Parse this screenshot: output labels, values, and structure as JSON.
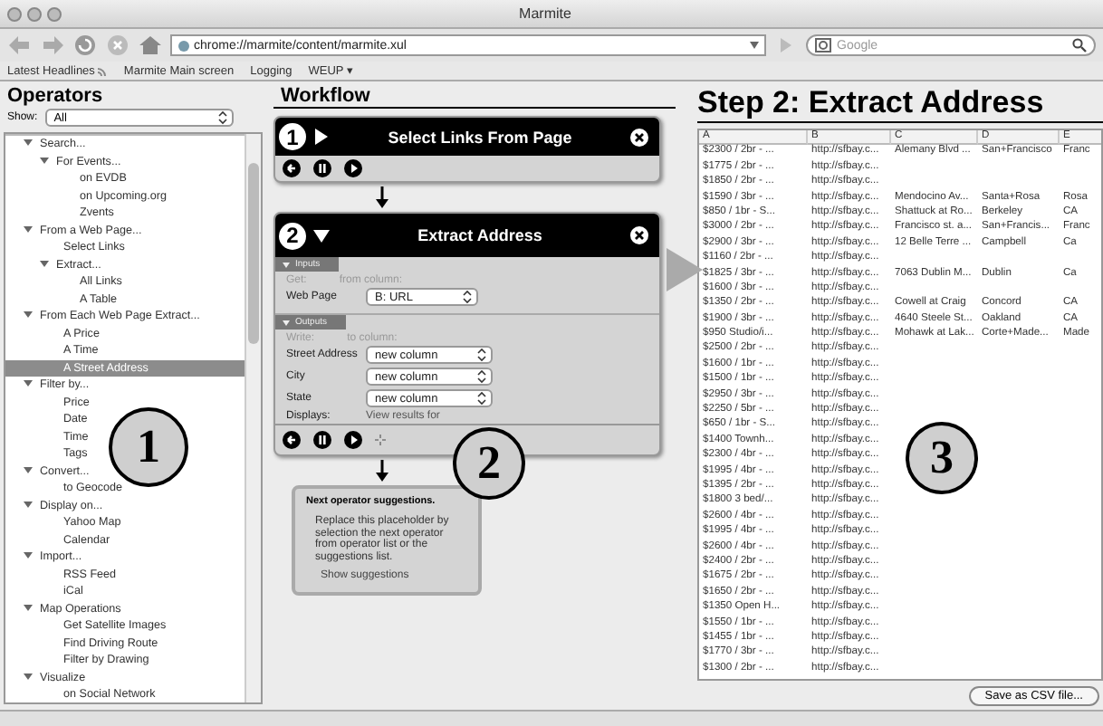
{
  "window": {
    "title": "Marmite"
  },
  "toolbar": {
    "url": "chrome://marmite/content/marmite.xul",
    "search_placeholder": "Google"
  },
  "bookmarks": [
    {
      "label": "Latest Headlines",
      "kind": "feed"
    },
    {
      "label": "Marmite Main screen",
      "kind": "link"
    },
    {
      "label": "Logging",
      "kind": "link"
    },
    {
      "label": "WEUP ▾",
      "kind": "link"
    }
  ],
  "operators": {
    "title": "Operators",
    "show_label": "Show:",
    "show_value": "All",
    "tree": [
      {
        "label": "Search...",
        "expanded": true,
        "selected": false,
        "children": [
          {
            "label": "For Events...",
            "expanded": true,
            "selected": false,
            "children": [
              {
                "label": "on EVDB",
                "selected": false
              },
              {
                "label": "on Upcoming.org",
                "selected": false
              },
              {
                "label": "Zvents",
                "selected": false
              }
            ]
          }
        ]
      },
      {
        "label": "From a Web Page...",
        "expanded": true,
        "selected": false,
        "children": [
          {
            "label": "Select Links",
            "selected": false
          },
          {
            "label": "Extract...",
            "expanded": true,
            "selected": false,
            "children": [
              {
                "label": "All Links",
                "selected": false
              },
              {
                "label": "A Table",
                "selected": false
              }
            ]
          }
        ]
      },
      {
        "label": "From Each Web Page Extract...",
        "expanded": true,
        "selected": false,
        "children": [
          {
            "label": "A Price",
            "selected": false
          },
          {
            "label": "A Time",
            "selected": false
          },
          {
            "label": "A Street Address",
            "selected": true
          }
        ]
      },
      {
        "label": "Filter by...",
        "expanded": true,
        "selected": false,
        "children": [
          {
            "label": "Price",
            "selected": false
          },
          {
            "label": "Date",
            "selected": false
          },
          {
            "label": "Time",
            "selected": false
          },
          {
            "label": "Tags",
            "selected": false
          }
        ]
      },
      {
        "label": "Convert...",
        "expanded": true,
        "selected": false,
        "children": [
          {
            "label": "to Geocode",
            "selected": false
          }
        ]
      },
      {
        "label": "Display on...",
        "expanded": true,
        "selected": false,
        "children": [
          {
            "label": "Yahoo Map",
            "selected": false
          },
          {
            "label": "Calendar",
            "selected": false
          }
        ]
      },
      {
        "label": "Import...",
        "expanded": true,
        "selected": false,
        "children": [
          {
            "label": "RSS Feed",
            "selected": false
          },
          {
            "label": "iCal",
            "selected": false
          }
        ]
      },
      {
        "label": "Map Operations",
        "expanded": true,
        "selected": false,
        "children": [
          {
            "label": "Get Satellite Images",
            "selected": false
          },
          {
            "label": "Find Driving Route",
            "selected": false
          },
          {
            "label": "Filter by Drawing",
            "selected": false
          }
        ]
      },
      {
        "label": "Visualize",
        "expanded": true,
        "selected": false,
        "children": [
          {
            "label": "on Social Network",
            "selected": false
          }
        ]
      }
    ]
  },
  "workflow": {
    "title": "Workflow",
    "steps": [
      {
        "number": "1",
        "title": "Select Links From Page",
        "expanded": false
      },
      {
        "number": "2",
        "title": "Extract Address",
        "expanded": true,
        "inputs_label": "Inputs",
        "get_label": "Get:",
        "from_label": "from column:",
        "input_fields": [
          {
            "label": "Web Page",
            "value": "B: URL"
          }
        ],
        "outputs_label": "Outputs",
        "write_label": "Write:",
        "to_label": "to column:",
        "output_fields": [
          {
            "label": "Street Address",
            "value": "new column"
          },
          {
            "label": "City",
            "value": "new column"
          },
          {
            "label": "State",
            "value": "new column"
          }
        ],
        "displays_label": "Displays:",
        "view_results": "View results for"
      }
    ],
    "suggestion": {
      "title": "Next operator suggestions.",
      "text": "Replace this placeholder by selection the next operator from operator list or the suggestions list.",
      "link": "Show suggestions"
    }
  },
  "results": {
    "title": "Step 2: Extract Address",
    "columns": [
      "A",
      "B",
      "C",
      "D",
      "E"
    ],
    "rows": [
      [
        "$2300 / 2br - ...",
        "http://sfbay.c...",
        "Alemany Blvd ...",
        "San+Francisco",
        "Franc"
      ],
      [
        "$1775 / 2br - ...",
        "http://sfbay.c..."
      ],
      [
        "$1850 / 2br - ...",
        "http://sfbay.c..."
      ],
      [
        "$1590 / 3br - ...",
        "http://sfbay.c...",
        "Mendocino Av...",
        "Santa+Rosa",
        "Rosa"
      ],
      [
        "$850 / 1br - S...",
        "http://sfbay.c...",
        "Shattuck at Ro...",
        "Berkeley",
        "CA"
      ],
      [
        "$3000 / 2br - ...",
        "http://sfbay.c...",
        "Francisco st. a...",
        "San+Francis...",
        "Franc"
      ],
      [
        "$2900 / 3br - ...",
        "http://sfbay.c...",
        "12 Belle Terre ...",
        "Campbell",
        "Ca"
      ],
      [
        "$1160 / 2br - ...",
        "http://sfbay.c..."
      ],
      [
        "$1825 / 3br - ...",
        "http://sfbay.c...",
        "7063 Dublin M...",
        "Dublin",
        "Ca"
      ],
      [
        "$1600 / 3br - ...",
        "http://sfbay.c..."
      ],
      [
        "$1350 / 2br - ...",
        "http://sfbay.c...",
        "Cowell at Craig",
        "Concord",
        "CA"
      ],
      [
        "$1900 / 3br - ...",
        "http://sfbay.c...",
        "4640 Steele St...",
        "Oakland",
        "CA"
      ],
      [
        "$950 Studio/i...",
        "http://sfbay.c...",
        "Mohawk at Lak...",
        "Corte+Made...",
        "Made"
      ],
      [
        "$2500 / 2br - ...",
        "http://sfbay.c..."
      ],
      [
        "$1600 / 1br - ...",
        "http://sfbay.c..."
      ],
      [
        "$1500 / 1br - ...",
        "http://sfbay.c..."
      ],
      [
        "$2950 / 3br - ...",
        "http://sfbay.c..."
      ],
      [
        "$2250 / 5br - ...",
        "http://sfbay.c..."
      ],
      [
        "$650 / 1br - S...",
        "http://sfbay.c..."
      ],
      [
        "$1400 Townh...",
        "http://sfbay.c..."
      ],
      [
        "$2300 / 4br - ...",
        "http://sfbay.c..."
      ],
      [
        "$1995 / 4br - ...",
        "http://sfbay.c..."
      ],
      [
        "$1395 / 2br - ...",
        "http://sfbay.c..."
      ],
      [
        "$1800 3 bed/...",
        "http://sfbay.c..."
      ],
      [
        "$2600 / 4br - ...",
        "http://sfbay.c..."
      ],
      [
        "$1995 / 4br - ...",
        "http://sfbay.c..."
      ],
      [
        "$2600 / 4br - ...",
        "http://sfbay.c..."
      ],
      [
        "$2400 / 2br - ...",
        "http://sfbay.c..."
      ],
      [
        "$1675 / 2br - ...",
        "http://sfbay.c..."
      ],
      [
        "$1650 / 2br - ...",
        "http://sfbay.c..."
      ],
      [
        "$1350 Open H...",
        "http://sfbay.c..."
      ],
      [
        "$1550 / 1br - ...",
        "http://sfbay.c..."
      ],
      [
        "$1455 / 1br - ...",
        "http://sfbay.c..."
      ],
      [
        "$1770 / 3br - ...",
        "http://sfbay.c..."
      ],
      [
        "$1300 / 2br - ...",
        "http://sfbay.c..."
      ]
    ],
    "save_button": "Save as CSV file..."
  },
  "callouts": [
    "1",
    "2",
    "3"
  ]
}
